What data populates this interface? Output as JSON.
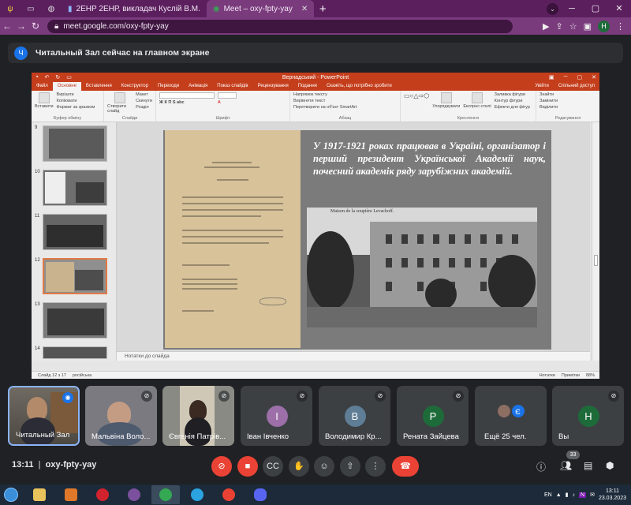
{
  "browser": {
    "tabs": [
      {
        "label": "2ЕНР 2ЕНР, викладач Куслій В.М.",
        "active": false
      },
      {
        "label": "Meet – oxy-fpty-yay",
        "active": true
      }
    ],
    "url": "meet.google.com/oxy-fpty-yay",
    "profile_initial": "Н"
  },
  "banner": {
    "avatar_initial": "Ч",
    "text": "Читальный Зал сейчас на главном экране"
  },
  "powerpoint": {
    "window_title": "Вернадський - PowerPoint",
    "tabs": [
      "Файл",
      "Основне",
      "Вставлення",
      "Конструктор",
      "Переходи",
      "Анімація",
      "Показ слайдів",
      "Рецензування",
      "Подання",
      "Скажіть, що потрібно зробити"
    ],
    "account": [
      "Увійти",
      "Спільний доступ"
    ],
    "ribbon_groups": [
      "Буфер обміну",
      "Слайди",
      "Шрифт",
      "Абзац",
      "Креслення",
      "Редагування"
    ],
    "ribbon_items": {
      "paste": "Вставити",
      "cut": "Вирізати",
      "copy": "Копіювати",
      "format_painter": "Формат за зразком",
      "new_slide": "Створити слайд",
      "layout": "Макет",
      "reset": "Скинути",
      "section": "Розділ",
      "text_direction": "Напрямок тексту",
      "align_text": "Вирівняти текст",
      "smartart": "Перетворити на об'єкт SmartArt",
      "quick_styles": "Експрес-стилі",
      "arrange": "Упорядкувати",
      "shape_fill": "Заливка фігури",
      "shape_outline": "Контур фігури",
      "shape_effects": "Ефекти для фігур",
      "find": "Знайти",
      "replace": "Замінити",
      "select": "Виділити"
    },
    "thumbnails": [
      {
        "num": "9",
        "selected": false
      },
      {
        "num": "10",
        "selected": false
      },
      {
        "num": "11",
        "selected": false
      },
      {
        "num": "12",
        "selected": true
      },
      {
        "num": "13",
        "selected": false
      },
      {
        "num": "14",
        "selected": false
      }
    ],
    "slide_text": "У 1917-1921 роках працював в Україні, організатор і перший президент Української Академії наук, почесний академік ряду зарубіжних академій.",
    "photo_caption": "Maison de la soupière Levachoff.",
    "notes_placeholder": "Нотатки до слайда",
    "status_left": "Слайд 12 з 17",
    "status_lang": "російська",
    "status_notes": "Нотатки",
    "status_comments": "Примітки",
    "zoom": "88%"
  },
  "participants": [
    {
      "name": "Читальный Зал",
      "type": "video",
      "mic": "talk"
    },
    {
      "name": "Мальвіна Воло...",
      "type": "video",
      "mic": "off"
    },
    {
      "name": "Євгенія Патрів...",
      "type": "video",
      "mic": "off"
    },
    {
      "name": "Іван Івченко",
      "type": "avatar",
      "initial": "І",
      "color": "#9c6fa8",
      "mic": "off"
    },
    {
      "name": "Володимир Кр...",
      "type": "avatar",
      "initial": "В",
      "color": "#5f7d95",
      "mic": "off"
    },
    {
      "name": "Рената Зайцева",
      "type": "avatar",
      "initial": "Р",
      "color": "#1e6b3a",
      "mic": "off"
    },
    {
      "name": "Ещё 25 чел.",
      "type": "more",
      "initial": "Є"
    },
    {
      "name": "Вы",
      "type": "avatar",
      "initial": "Н",
      "color": "#1e6b3a",
      "mic": "off"
    }
  ],
  "controls": {
    "time": "13:11",
    "meeting_code": "oxy-fpty-yay",
    "people_count": "33"
  },
  "taskbar": {
    "lang": "EN",
    "time": "13:11",
    "date": "23.03.2023"
  }
}
